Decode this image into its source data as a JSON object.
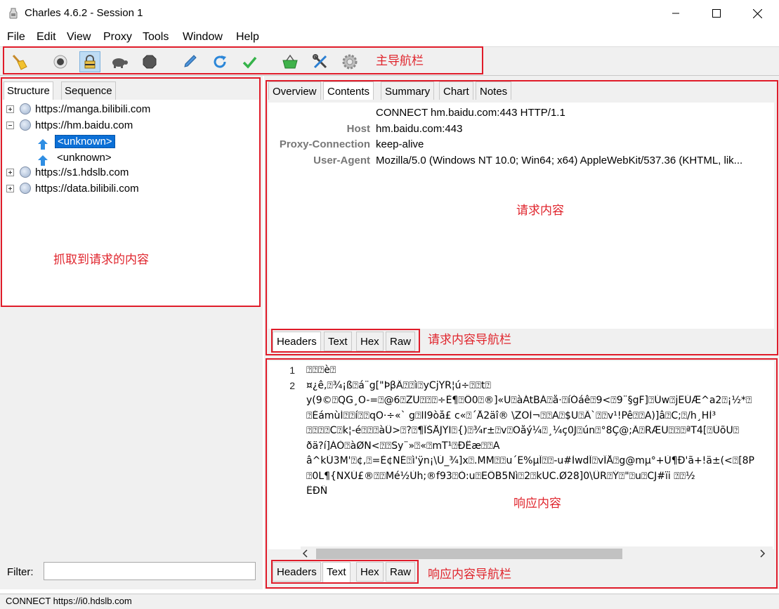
{
  "window": {
    "title": "Charles 4.6.2 - Session 1",
    "controls": {
      "minimize": "minimize-icon",
      "maximize": "maximize-icon",
      "close": "close-icon"
    }
  },
  "menu": [
    "File",
    "Edit",
    "View",
    "Proxy",
    "Tools",
    "Window",
    "Help"
  ],
  "toolbar": {
    "icons": [
      "broom-icon",
      "record-icon",
      "ssl-lock-icon",
      "turtle-throttle-icon",
      "breakpoint-stop-icon",
      "pen-compose-icon",
      "refresh-icon",
      "check-validate-icon",
      "basket-icon",
      "tools-icon",
      "gear-icon"
    ],
    "active_icon": "ssl-lock-icon"
  },
  "left": {
    "tabs": [
      "Structure",
      "Sequence"
    ],
    "selected_tab": "Structure",
    "tree": [
      {
        "label": "https://manga.bilibili.com",
        "expanded": false
      },
      {
        "label": "https://hm.baidu.com",
        "expanded": true,
        "children": [
          {
            "label": "<unknown>",
            "selected": true
          },
          {
            "label": "<unknown>",
            "selected": false
          }
        ]
      },
      {
        "label": "https://s1.hdslb.com",
        "expanded": false
      },
      {
        "label": "https://data.bilibili.com",
        "expanded": false
      }
    ],
    "filter_label": "Filter:",
    "filter_value": ""
  },
  "right": {
    "tabs": [
      "Overview",
      "Contents",
      "Summary",
      "Chart",
      "Notes"
    ],
    "selected_tab": "Contents",
    "request": {
      "first_line": "CONNECT hm.baidu.com:443 HTTP/1.1",
      "headers": [
        {
          "name": "Host",
          "value": "hm.baidu.com:443"
        },
        {
          "name": "Proxy-Connection",
          "value": "keep-alive"
        },
        {
          "name": "User-Agent",
          "value": "Mozilla/5.0 (Windows NT 10.0; Win64; x64) AppleWebKit/537.36 (KHTML, lik..."
        }
      ],
      "subtabs": [
        "Headers",
        "Text",
        "Hex",
        "Raw"
      ],
      "selected_subtab": "Headers"
    },
    "response": {
      "line_numbers": [
        "1",
        "2"
      ],
      "lines": [
        "⍰⍰⍰è⍰",
        "¤¿ê,⍰¾¡ß⍰á¨g[\"ÞβÂ⍰⍰ì⍰yCjYR¦ú÷⍰⍰t⍰",
        "y(9©⍰QG¸Ö-=⍰@6⍰ZÜ⍰⍰⍰÷È¶⍰Ô0⍰®]«U⍰àÁtBÁ⍰å·⍰íÓáê⍰9<⍰9¨§gF]⍰Úw⍰jEÚÆ^a2⍰¡½*⍰",
        "⍰ÉámùÍ⍰⍰í⍰⍰qÖ·÷«`        g⍰II9òå£ c«⍰´Å2äî®         \\ZÖÌ¬⍰⍰A⍰$U⍰Ã`⍰⍰v¹!Pê⍰⍰A)]â⍰C;⍰/h¸HÌ³",
        "⍰⍰⍰⍰C⍰k¦-é⍰⍰⍰àÛ>⍰?⍰¶ÏŠÅJYI⍰{)⍰¾r±⍰v⍰Õåý¼⍰¸¼ç0J⍰ún⍰°8Ç@;Ã⍰RÆÜ⍰⍰⍰ªT4[⍰ÙõÜ⍰",
        "ðä?í]ÁÒ⍰àØN<⍰⍰Sy¨»⍰«⍰mT¹⍰ÐÊæ⍰⍰A",
        "â^kÚ3M'⍰¢,⍰=È¢NÉ⍰ì'ÿn¡\\Ú_¾]x⍰.MM⍰⍰u´E%µÎ⍰⍰-u#ÌwdÏ⍰vÏÅ⍰g@mµ°+Ù¶Ð'ã+!ä±(<⍰[8P",
        "⍰0L¶{NXÚ£®⍰⍰Mé½Ùh;®f93⍰Ò:u⍰EÔB5Nì⍰2⍰kÜC.Ø28]0\\ÛR⍰Ý⍰\"⍰u⍰CJ#ïi                ⍰⍰½",
        "ËÐÑ"
      ],
      "subtabs": [
        "Headers",
        "Text",
        "Hex",
        "Raw"
      ],
      "selected_subtab": "Text"
    }
  },
  "annotations": {
    "toolbar": "主导航栏",
    "tree": "抓取到请求的内容",
    "request": "请求内容",
    "request_nav": "请求内容导航栏",
    "response": "响应内容",
    "response_nav": "响应内容导航栏",
    "color": "#e01c2a"
  },
  "status": "CONNECT https://i0.hdslb.com"
}
